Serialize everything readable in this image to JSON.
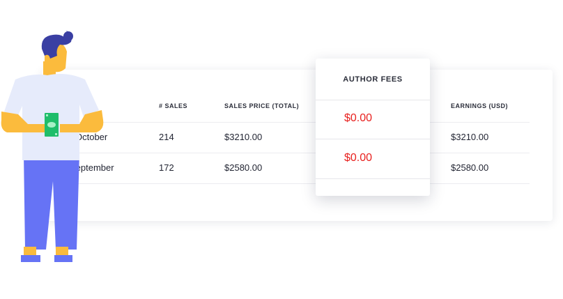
{
  "table": {
    "headers": [
      "# SALES",
      "SALES PRICE (TOTAL)",
      "EARNINGS (USD)"
    ],
    "rows": [
      {
        "month": "October",
        "sales": "214",
        "sales_price": "$3210.00",
        "earnings": "$3210.00"
      },
      {
        "month": "September",
        "sales": "172",
        "sales_price": "$2580.00",
        "earnings": "$2580.00"
      }
    ]
  },
  "fees_card": {
    "title": "AUTHOR FEES",
    "values": [
      "$0.00",
      "$0.00"
    ]
  },
  "colors": {
    "fee_red": "#e8201e",
    "shirt": "#e6ebfb",
    "pants": "#6673f5",
    "hair": "#3a3fa3",
    "skin": "#fbbb3d",
    "money": "#1fbd6a"
  },
  "illustration": {
    "icon": "person-holding-money-icon"
  }
}
